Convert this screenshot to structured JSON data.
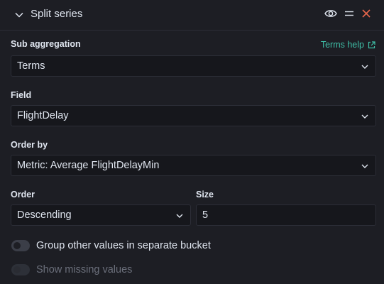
{
  "header": {
    "title": "Split series"
  },
  "sub_aggregation": {
    "label": "Sub aggregation",
    "help": "Terms help",
    "value": "Terms"
  },
  "field": {
    "label": "Field",
    "value": "FlightDelay"
  },
  "order_by": {
    "label": "Order by",
    "value": "Metric: Average FlightDelayMin"
  },
  "order": {
    "label": "Order",
    "value": "Descending"
  },
  "size": {
    "label": "Size",
    "value": "5"
  },
  "toggles": {
    "group_other": {
      "label": "Group other values in separate bucket",
      "on": false
    },
    "show_missing": {
      "label": "Show missing values",
      "on": false,
      "disabled": true
    }
  },
  "colors": {
    "accent": "#3fbfa7",
    "danger": "#e7664c",
    "background": "#1d1e24",
    "field_bg": "#16171c"
  },
  "icons": [
    "chevron-down-icon",
    "eye-icon",
    "drag-handle-icon",
    "close-icon",
    "external-link-icon"
  ]
}
